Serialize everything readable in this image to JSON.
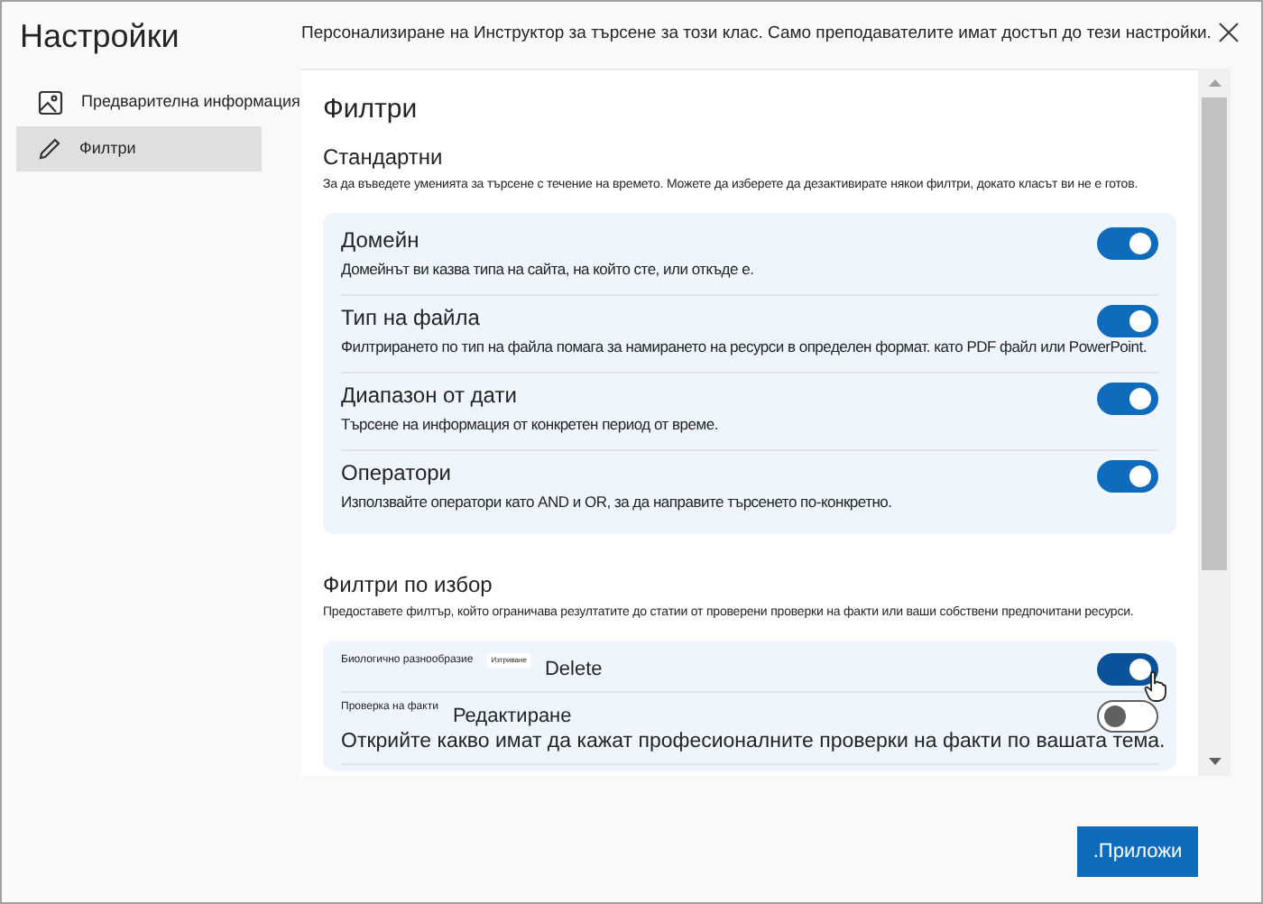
{
  "title": "Настройки",
  "sidebar": {
    "items": [
      {
        "label": "Предварителна информация",
        "selected": false
      },
      {
        "label": "Филтри",
        "selected": true
      }
    ]
  },
  "header_note": "Персонализиране на Инструктор за търсене за този клас. Само преподавателите имат достъп до тези настройки.",
  "panel_title": "Филтри",
  "sections": [
    {
      "title": "Стандартни",
      "description": "За да въведете уменията за търсене с течение на времето. Можете да изберете да дезактивирате някои филтри, докато класът ви не е готов.",
      "filters": [
        {
          "kind": "plain",
          "title": "Домейн",
          "description": "Домейнът ви казва типа на сайта, на който сте, или откъде е.",
          "on": true,
          "hovered": false
        },
        {
          "kind": "plain",
          "title": "Тип на файла",
          "description": "Филтрирането по тип на файла помага за намирането на ресурси в определен формат. като PDF файл или PowerPoint.",
          "on": true,
          "hovered": false
        },
        {
          "kind": "plain",
          "title": "Диапазон от дати",
          "description": "Търсене на информация от конкретен период от време.",
          "on": true,
          "hovered": false
        },
        {
          "kind": "plain",
          "title": "Оператори",
          "description": "Използвайте оператори като AND и OR, за да направите търсенето по-конкретно.",
          "on": true,
          "hovered": false
        }
      ]
    },
    {
      "title": "Филтри по избор",
      "description": "Предоставете филтър, който ограничава резултатите до статии от проверени проверки на факти или ваши собствени предпочитани ресурси.",
      "filters": [
        {
          "kind": "custom",
          "title": "Биологично разнообразие",
          "tag": "Изтриване",
          "action": "Delete",
          "on": true,
          "hovered": true
        },
        {
          "kind": "custom",
          "title": "Проверка на факти",
          "action": "Редактиране",
          "description": "Открийте какво имат да кажат професионалните проверки на факти по вашата тема.",
          "on": false,
          "hovered": false
        }
      ]
    }
  ],
  "apply_button": ".Приложи"
}
